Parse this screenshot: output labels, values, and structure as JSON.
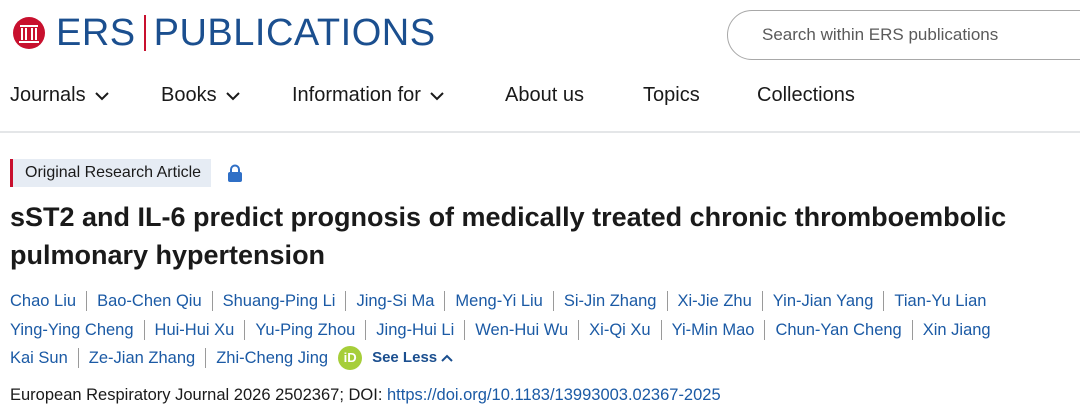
{
  "logo": {
    "brand": "ERS",
    "name": "PUBLICATIONS"
  },
  "search": {
    "placeholder": "Search within ERS publications"
  },
  "nav": {
    "journals": "Journals",
    "books": "Books",
    "information_for": "Information for",
    "about_us": "About us",
    "topics": "Topics",
    "collections": "Collections"
  },
  "article": {
    "type_badge": "Original Research Article",
    "title": "sST2 and IL-6 predict prognosis of medically treated chronic thromboembolic pulmonary hypertension",
    "authors": [
      "Chao Liu",
      "Bao-Chen Qiu",
      "Shuang-Ping Li",
      "Jing-Si Ma",
      "Meng-Yi Liu",
      "Si-Jin Zhang",
      "Xi-Jie Zhu",
      "Yin-Jian Yang",
      "Tian-Yu Lian",
      "Ying-Ying Cheng",
      "Hui-Hui Xu",
      "Yu-Ping Zhou",
      "Jing-Hui Li",
      "Wen-Hui Wu",
      "Xi-Qi Xu",
      "Yi-Min Mao",
      "Chun-Yan Cheng",
      "Xin Jiang",
      "Kai Sun",
      "Ze-Jian Zhang",
      "Zhi-Cheng Jing"
    ],
    "orcid_label": "iD",
    "see_less": "See Less",
    "citation": "European Respiratory Journal 2026 2502367; DOI: ",
    "doi": "https://doi.org/10.1183/13993003.02367-2025"
  },
  "colors": {
    "brand_blue": "#1b4f8f",
    "brand_red": "#c8102e",
    "link_blue": "#1b5aa5",
    "orcid_green": "#a6ce39"
  }
}
